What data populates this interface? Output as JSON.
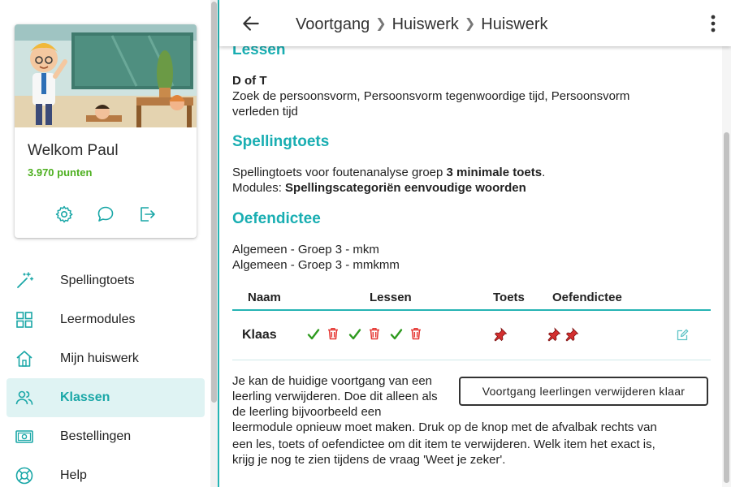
{
  "sidebar": {
    "welcome": "Welkom Paul",
    "points": "3.970 punten",
    "card_icons": [
      "gear-icon",
      "chat-icon",
      "logout-icon"
    ],
    "nav": [
      {
        "label": "Spellingtoets",
        "icon": "magic-wand-icon"
      },
      {
        "label": "Leermodules",
        "icon": "grid-icon"
      },
      {
        "label": "Mijn huiswerk",
        "icon": "home-icon"
      },
      {
        "label": "Klassen",
        "icon": "users-icon",
        "active": true
      },
      {
        "label": "Bestellingen",
        "icon": "money-icon"
      },
      {
        "label": "Help",
        "icon": "lifebuoy-icon"
      }
    ]
  },
  "header": {
    "crumbs": [
      "Voortgang",
      "Huiswerk",
      "Huiswerk"
    ]
  },
  "main": {
    "lessen": {
      "title": "Lessen",
      "lesson_name": "D of T",
      "lesson_desc_1": "Zoek de persoonsvorm, Persoonsvorm tegenwoordige tijd, Persoonsvorm",
      "lesson_desc_2": "verleden tijd"
    },
    "spellingtoets": {
      "title": "Spellingtoets",
      "line1_pre": "Spellingtoets voor foutenanalyse groep ",
      "line1_bold": "3  minimale toets",
      "line1_post": ".",
      "line2_pre": "Modules: ",
      "line2_bold": "Spellingscategoriën eenvoudige woorden"
    },
    "oefendictee": {
      "title": "Oefendictee",
      "items": [
        "Algemeen - Groep 3 - mkm",
        "Algemeen - Groep 3 - mmkmm"
      ]
    },
    "table": {
      "headers": {
        "naam": "Naam",
        "lessen": "Lessen",
        "toets": "Toets",
        "oefendictee": "Oefendictee"
      },
      "rows": [
        {
          "name": "Klaas",
          "lessons_done": 3,
          "toets_pins": 1,
          "dictee_pins": 2
        }
      ]
    },
    "info_text_1": "Je kan de huidige voortgang van een",
    "info_text_2": "leerling verwijderen. Doe dit alleen als",
    "info_text_3": "de leerling bijvoorbeeld een",
    "info_text_4": "leermodule opnieuw moet maken. Druk op de knop met de afvalbak rechts van",
    "info_text_5": "een les, toets of oefendictee om dit item te verwijderen. Welk item het exact is,",
    "info_text_6": "krijg je nog te zien tijdens de vraag 'Weet je zeker'.",
    "action_button": "Voortgang leerlingen verwijderen klaar"
  },
  "colors": {
    "accent": "#19aeb2",
    "points": "#4caf1e",
    "check": "#2e9a1f",
    "trash": "#e53935",
    "pin": "#d32f2f"
  }
}
